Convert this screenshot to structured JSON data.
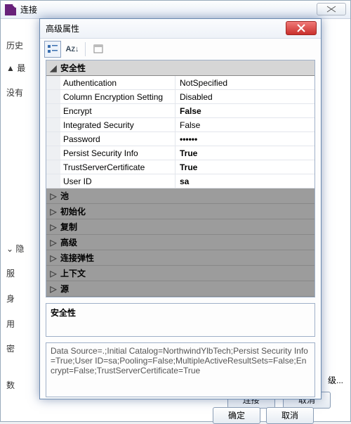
{
  "outer": {
    "title": "连接",
    "closeLabel": "close"
  },
  "side": {
    "history": "历史",
    "recent": "最",
    "norec": "没有",
    "hidden": "隐",
    "server": "服",
    "id": "身",
    "user": "用",
    "pwd": "密",
    "db": "数",
    "more": "级..."
  },
  "dialog": {
    "title": "高级属性",
    "toolbar": {
      "categorized": "categorized-icon",
      "alpha": "alpha-sort-icon",
      "pages": "property-pages-icon"
    },
    "categories": {
      "security": {
        "label": "安全性",
        "props": [
          {
            "name": "Authentication",
            "value": "NotSpecified",
            "bold": false
          },
          {
            "name": "Column Encryption Setting",
            "value": "Disabled",
            "bold": false
          },
          {
            "name": "Encrypt",
            "value": "False",
            "bold": true
          },
          {
            "name": "Integrated Security",
            "value": "False",
            "bold": false
          },
          {
            "name": "Password",
            "value": "••••••",
            "bold": true
          },
          {
            "name": "Persist Security Info",
            "value": "True",
            "bold": true
          },
          {
            "name": "TrustServerCertificate",
            "value": "True",
            "bold": true
          },
          {
            "name": "User ID",
            "value": "sa",
            "bold": true
          }
        ]
      },
      "collapsed": [
        {
          "label": "池"
        },
        {
          "label": "初始化"
        },
        {
          "label": "复制"
        },
        {
          "label": "高级"
        },
        {
          "label": "连接弹性"
        },
        {
          "label": "上下文"
        },
        {
          "label": "源"
        }
      ]
    },
    "descriptionTitle": "安全性",
    "connectionString": "Data Source=.;Initial Catalog=NorthwindYlbTech;Persist Security Info=True;User ID=sa;Pooling=False;MultipleActiveResultSets=False;Encrypt=False;TrustServerCertificate=True",
    "buttons": {
      "ok": "确定",
      "cancel": "取消"
    }
  },
  "outerButtons": {
    "connect": "连接",
    "cancel": "取消"
  }
}
